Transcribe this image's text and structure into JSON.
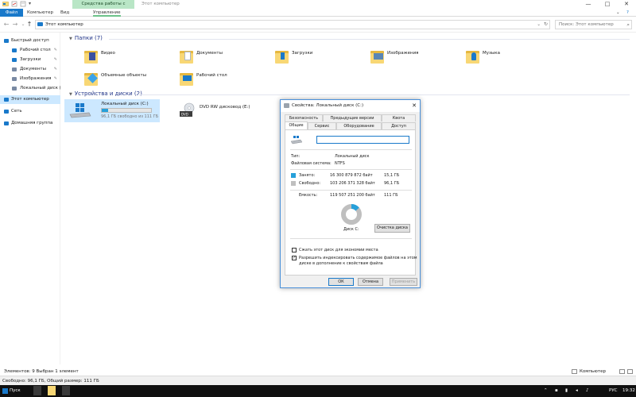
{
  "window": {
    "title": "Этот компьютер",
    "context_group": "Средства работы с дисками",
    "minimize": "—",
    "maximize": "□",
    "close": "✕"
  },
  "ribbon": {
    "tabs": [
      {
        "label": "Файл"
      },
      {
        "label": "Компьютер"
      },
      {
        "label": "Вид"
      },
      {
        "label": "Управление"
      }
    ],
    "expand": "⌄",
    "help": "?"
  },
  "address": {
    "back": "←",
    "forward": "→",
    "recent": "⌄",
    "up": "↑",
    "path": "Этот компьютер",
    "dropdown": "⌄",
    "refresh": "↻",
    "search_placeholder": "Поиск: Этот компьютер",
    "search_icon": "search-icon"
  },
  "nav": {
    "items": [
      {
        "label": "Быстрый доступ",
        "icon": "star-icon",
        "color": "#1979ca"
      },
      {
        "label": "Рабочий стол",
        "icon": "desktop-icon",
        "color": "#1979ca",
        "pinned": true
      },
      {
        "label": "Загрузки",
        "icon": "download-icon",
        "color": "#1979ca",
        "pinned": true
      },
      {
        "label": "Документы",
        "icon": "documents-icon",
        "color": "#7a8aa3",
        "pinned": true
      },
      {
        "label": "Изображения",
        "icon": "pictures-icon",
        "color": "#7a8aa3",
        "pinned": true
      },
      {
        "label": "Локальный диск (С",
        "icon": "drive-icon",
        "color": "#7a8aa3"
      },
      {
        "label": "Этот компьютер",
        "icon": "computer-icon",
        "color": "#1979ca",
        "selected": true
      },
      {
        "label": "Сеть",
        "icon": "network-icon",
        "color": "#1979ca"
      },
      {
        "label": "Домашняя группа",
        "icon": "homegroup-icon",
        "color": "#1979ca"
      }
    ],
    "pin_glyph": "✎"
  },
  "content": {
    "folders_group": "Папки (7)",
    "folders": [
      {
        "name": "Видео",
        "icon": "video-folder-icon",
        "accent": "#3a4fa0"
      },
      {
        "name": "Документы",
        "icon": "documents-folder-icon",
        "accent": "#d6dbe3"
      },
      {
        "name": "Загрузки",
        "icon": "downloads-folder-icon",
        "accent": "#1979ca"
      },
      {
        "name": "Изображения",
        "icon": "pictures-folder-icon",
        "accent": "#5a86b4"
      },
      {
        "name": "Музыка",
        "icon": "music-folder-icon",
        "accent": "#1979ca"
      },
      {
        "name": "Объемные объекты",
        "icon": "3d-objects-folder-icon",
        "accent": "#3ba3e8"
      },
      {
        "name": "Рабочий стол",
        "icon": "desktop-folder-icon",
        "accent": "#1979ca"
      }
    ],
    "devices_group": "Устройства и диски (2)",
    "drives": [
      {
        "name": "Локальный диск (C:)",
        "free_text": "96,1 ГБ свободно из 111 ГБ",
        "used_fraction": 0.135,
        "icon": "windows-drive-icon"
      },
      {
        "name": "DVD RW дисковод (E:)",
        "icon": "dvd-drive-icon"
      }
    ]
  },
  "statusbar": {
    "left": "Элементов: 9    Выбран 1 элемент",
    "right": "Компьютер",
    "details": "Свободно: 96,1 ГБ, Общий размер: 111 ГБ"
  },
  "dialog": {
    "title": "Свойства: Локальный диск (C:)",
    "close": "✕",
    "tabs_row1": [
      "Безопасность",
      "Предыдущие версии",
      "Квота"
    ],
    "tabs_row2": [
      "Общие",
      "Сервис",
      "Оборудование",
      "Доступ"
    ],
    "name_value": "",
    "type_label": "Тип:",
    "type_value": "Локальный диск",
    "fs_label": "Файловая система:",
    "fs_value": "NTFS",
    "used_label": "Занято:",
    "used_bytes": "16 300 879 872 байт",
    "used_size": "15,1 ГБ",
    "free_label": "Свободно:",
    "free_bytes": "103 206 371 328 байт",
    "free_size": "96,1 ГБ",
    "cap_label": "Емкость:",
    "cap_bytes": "119 507 251 200 байт",
    "cap_size": "111 ГБ",
    "disk_label": "Диск С:",
    "cleanup": "Очистка диска",
    "compress": "Сжать этот диск для экономии места",
    "compress_checked": false,
    "index_line1": "Разрешить индексировать содержимое файлов на этом",
    "index_line2": "диске в дополнение к свойствам файла",
    "index_checked": true,
    "check_glyph": "✓",
    "ok": "ОК",
    "cancel": "Отмена",
    "apply": "Применить",
    "used_color": "#26a0da",
    "free_color": "#bfbfbf",
    "used_fraction": 0.136
  },
  "taskbar": {
    "start": "Пуск",
    "lang": "РУС",
    "time": "19:32",
    "tray_chevron": "⌃"
  }
}
